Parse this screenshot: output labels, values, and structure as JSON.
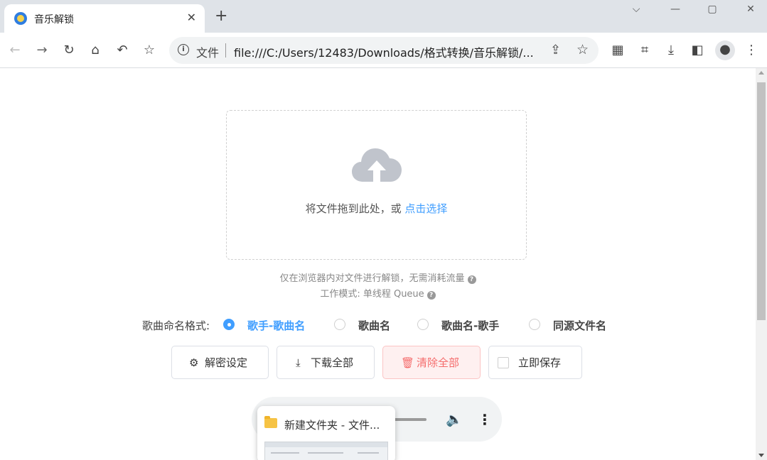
{
  "browser": {
    "tab": {
      "title": "音乐解锁"
    },
    "omnibox": {
      "label": "文件",
      "url": "file:///C:/Users/12483/Downloads/格式转换/音乐解锁/..."
    }
  },
  "upload": {
    "prompt": "将文件拖到此处，或",
    "link": "点击选择",
    "hint_local": "仅在浏览器内对文件进行解锁，无需消耗流量",
    "hint_mode": "工作模式: 单线程 Queue"
  },
  "naming": {
    "label": "歌曲命名格式:",
    "selected": 0,
    "options": [
      "歌手-歌曲名",
      "歌曲名",
      "歌曲名-歌手",
      "同源文件名"
    ]
  },
  "buttons": {
    "settings": "解密设定",
    "download_all": "下载全部",
    "clear_all": "清除全部",
    "save_now": "立即保存"
  },
  "popup": {
    "title": "新建文件夹 - 文件..."
  },
  "colors": {
    "accent": "#409eff",
    "danger": "#f56c6c"
  }
}
